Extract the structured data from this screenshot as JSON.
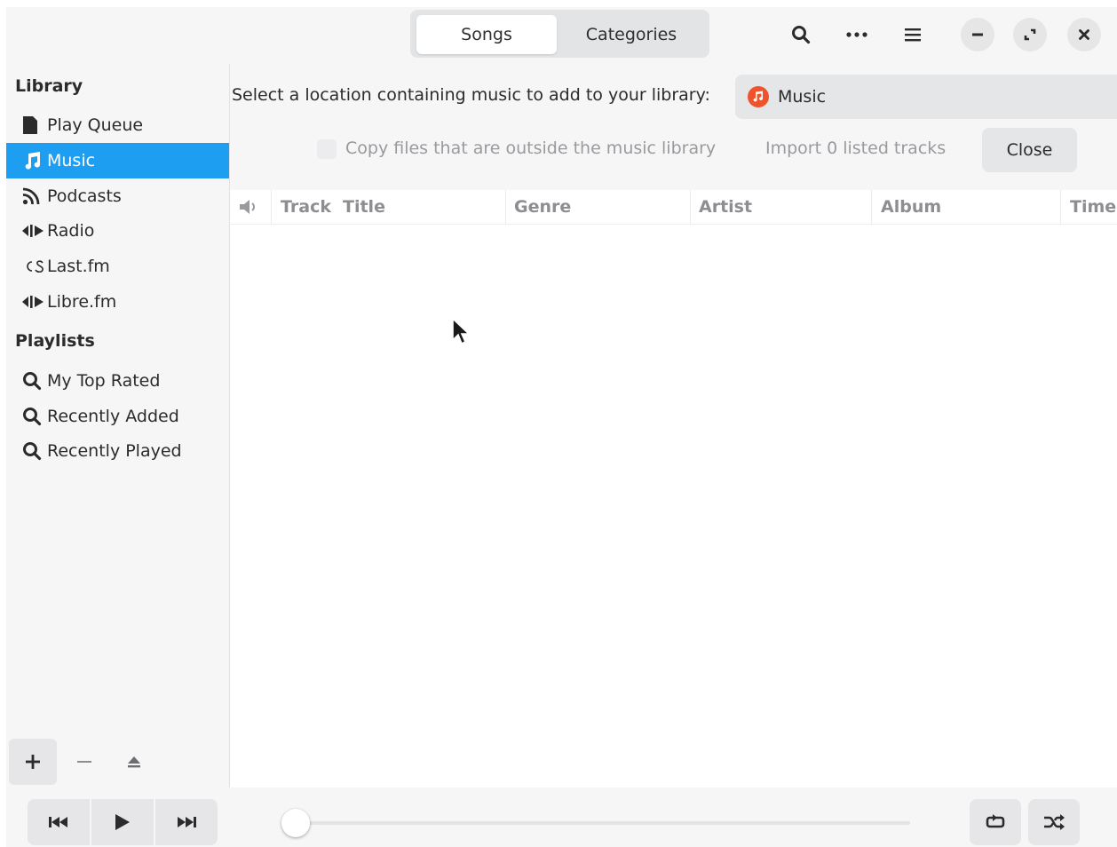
{
  "header": {
    "tabs": [
      {
        "label": "Songs",
        "active": true
      },
      {
        "label": "Categories",
        "active": false
      }
    ],
    "icons": [
      "search-icon",
      "more-icon",
      "hamburger-menu-icon"
    ],
    "window_controls": [
      "minimize-icon",
      "maximize-icon",
      "close-icon"
    ]
  },
  "sidebar": {
    "library_title": "Library",
    "library_items": [
      {
        "label": "Play Queue",
        "icon": "document-icon"
      },
      {
        "label": "Music",
        "icon": "music-note-icon",
        "selected": true
      },
      {
        "label": "Podcasts",
        "icon": "rss-icon"
      },
      {
        "label": "Radio",
        "icon": "radio-icon"
      },
      {
        "label": "Last.fm",
        "icon": "lastfm-icon"
      },
      {
        "label": "Libre.fm",
        "icon": "radio-icon"
      }
    ],
    "playlists_title": "Playlists",
    "playlist_items": [
      {
        "label": "My Top Rated",
        "icon": "search-icon"
      },
      {
        "label": "Recently Added",
        "icon": "search-icon"
      },
      {
        "label": "Recently Played",
        "icon": "search-icon"
      }
    ],
    "footer_icons": [
      "add-icon",
      "remove-icon",
      "eject-icon"
    ]
  },
  "import_bar": {
    "location_label": "Select a location containing music to add to your library:",
    "location_value": "Music",
    "copy_label": "Copy files that are outside the music library",
    "copy_checked": false,
    "import_label": "Import 0 listed tracks",
    "close_label": "Close"
  },
  "table": {
    "columns": [
      "Track",
      "Title",
      "Genre",
      "Artist",
      "Album",
      "Time"
    ],
    "rows": []
  },
  "player": {
    "buttons": [
      "previous-icon",
      "play-icon",
      "next-icon"
    ],
    "position_fraction": 0.0,
    "right_buttons": [
      "repeat-icon",
      "shuffle-icon"
    ]
  },
  "colors": {
    "accent": "#1e9ef1",
    "music_location_icon": "#f0522b",
    "background": "#f6f6f7"
  }
}
